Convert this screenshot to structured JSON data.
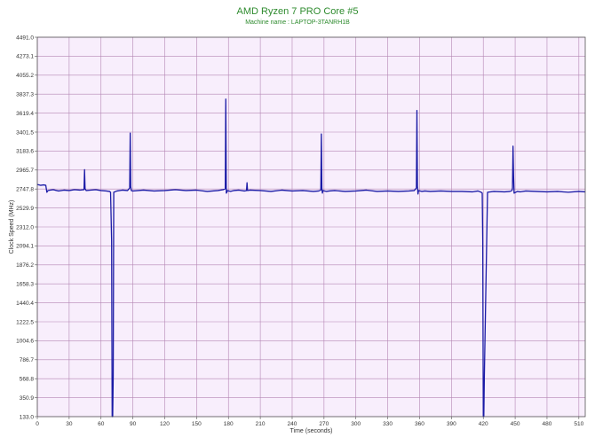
{
  "chart_data": {
    "type": "line",
    "title": "AMD Ryzen 7 PRO Core #5",
    "subtitle": "Machine name : LAPTOP-3TANRH1B",
    "xlabel": "Time (seconds)",
    "ylabel": "Clock Speed (MHz)",
    "xlim": [
      0,
      516
    ],
    "ylim": [
      133.0,
      4491.0
    ],
    "x_ticks": [
      0,
      30,
      60,
      90,
      120,
      150,
      180,
      210,
      240,
      270,
      300,
      330,
      360,
      390,
      420,
      450,
      480,
      510
    ],
    "y_ticks": [
      133.0,
      350.9,
      568.8,
      786.7,
      1004.6,
      1222.5,
      1440.4,
      1658.3,
      1876.2,
      2094.1,
      2312.0,
      2529.9,
      2747.8,
      2965.7,
      3183.6,
      3401.5,
      3619.4,
      3837.3,
      4055.2,
      4273.1,
      4491.0
    ],
    "grid": true,
    "background_color": "#f8eefc",
    "grid_color": "#b486b4",
    "series": [
      {
        "color": "#1a1aa6",
        "x": [
          0,
          3,
          6,
          8,
          9,
          10,
          12,
          15,
          20,
          25,
          30,
          35,
          40,
          44,
          44.5,
          45,
          46,
          50,
          55,
          60,
          65,
          68,
          69,
          70,
          70.5,
          71,
          71.5,
          72,
          75,
          80,
          85,
          87,
          87.5,
          88,
          88.5,
          90,
          95,
          100,
          110,
          120,
          130,
          140,
          150,
          160,
          170,
          175,
          177,
          177.5,
          178,
          178.5,
          179,
          182,
          185,
          190,
          195,
          197,
          197.5,
          198,
          200,
          210,
          220,
          230,
          240,
          250,
          260,
          265,
          267,
          267.5,
          268,
          268.5,
          269,
          272,
          275,
          280,
          290,
          300,
          310,
          320,
          330,
          340,
          350,
          355,
          357,
          357.5,
          358,
          358.5,
          359,
          362,
          365,
          370,
          380,
          390,
          400,
          410,
          415,
          418,
          419,
          419.5,
          420,
          420.5,
          421,
          424,
          430,
          440,
          445,
          447,
          447.5,
          448,
          448.5,
          449,
          452,
          455,
          460,
          470,
          480,
          490,
          500,
          510,
          516
        ],
        "y": [
          2800,
          2790,
          2795,
          2790,
          2710,
          2730,
          2735,
          2740,
          2725,
          2735,
          2730,
          2740,
          2735,
          2740,
          2970,
          2750,
          2730,
          2735,
          2740,
          2730,
          2725,
          2720,
          2710,
          2150,
          133,
          133,
          600,
          2710,
          2725,
          2735,
          2730,
          2760,
          3390,
          2780,
          2730,
          2725,
          2730,
          2735,
          2725,
          2730,
          2740,
          2730,
          2735,
          2720,
          2730,
          2740,
          2750,
          3780,
          2700,
          2710,
          2730,
          2720,
          2730,
          2735,
          2725,
          2730,
          2820,
          2730,
          2735,
          2730,
          2720,
          2735,
          2725,
          2730,
          2720,
          2725,
          2735,
          3380,
          2750,
          2700,
          2730,
          2720,
          2725,
          2730,
          2720,
          2725,
          2735,
          2720,
          2725,
          2720,
          2725,
          2730,
          2760,
          3650,
          2780,
          2690,
          2730,
          2720,
          2725,
          2720,
          2725,
          2720,
          2720,
          2715,
          2725,
          2710,
          2700,
          2150,
          133,
          133,
          600,
          2710,
          2720,
          2715,
          2720,
          2730,
          2760,
          3240,
          2900,
          2700,
          2720,
          2715,
          2725,
          2720,
          2715,
          2720,
          2710,
          2720,
          2715
        ]
      }
    ]
  }
}
